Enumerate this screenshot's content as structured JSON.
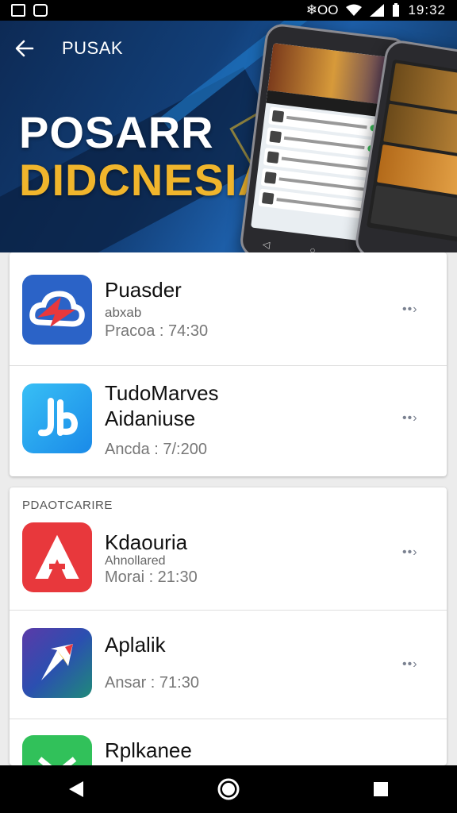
{
  "status_bar": {
    "time": "19:32",
    "network_label": "❄OO"
  },
  "header": {
    "title": "PUSAK"
  },
  "banner": {
    "line1": "POSARR",
    "line2": "DIDCNESIA"
  },
  "section1": {
    "items": [
      {
        "name": "Puasder",
        "sub": "abxab",
        "meta": "Pracoa : 74:30",
        "icon": "cloud-app-icon",
        "color": "#2b63c7"
      },
      {
        "name": "TudoMarves\nAidaniuse",
        "sub": "",
        "meta": "Ancda : 7/:200",
        "icon": "jb-app-icon",
        "color": "#1e9cf0"
      }
    ]
  },
  "section2": {
    "label": "PDAOTCARIRE",
    "items": [
      {
        "name": "Kdaouria",
        "sub": "Ahnollared",
        "meta": "Morai : 21:30",
        "icon": "a-letter-app-icon",
        "color": "#e8383c"
      },
      {
        "name": "Aplalik",
        "sub": "",
        "meta": "Ansar : 71:30",
        "icon": "arrow-app-icon",
        "color": "#3b3aa8"
      },
      {
        "name": "Rplkanee",
        "sub": "",
        "meta": "",
        "icon": "green-app-icon",
        "color": "#31c15a"
      }
    ]
  },
  "more_label": "••›",
  "colors": {
    "banner_accent": "#f0b52c",
    "status_bg": "#000000"
  }
}
